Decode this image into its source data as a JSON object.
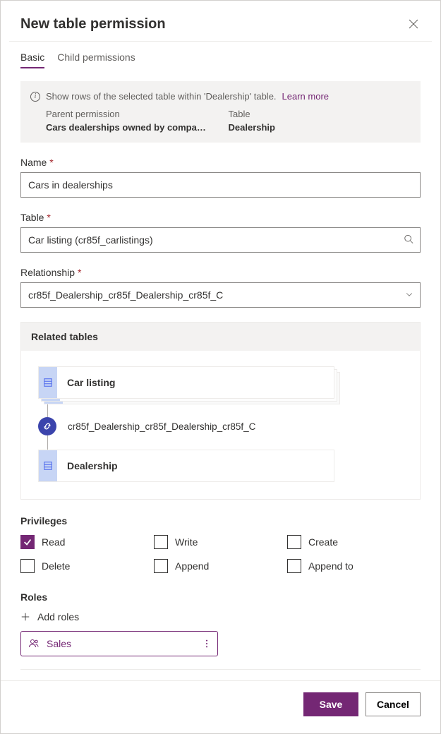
{
  "header": {
    "title": "New table permission"
  },
  "tabs": {
    "basic": "Basic",
    "child": "Child permissions"
  },
  "info": {
    "message": "Show rows of the selected table within 'Dealership' table.",
    "learn_more": "Learn more",
    "parent_permission_label": "Parent permission",
    "table_label": "Table",
    "parent_permission_value": "Cars dealerships owned by compa…",
    "table_value": "Dealership"
  },
  "fields": {
    "name_label": "Name",
    "name_value": "Cars in dealerships",
    "table_label": "Table",
    "table_value": "Car listing (cr85f_carlistings)",
    "relationship_label": "Relationship",
    "relationship_value": "cr85f_Dealership_cr85f_Dealership_cr85f_C"
  },
  "related": {
    "header": "Related tables",
    "top_table": "Car listing",
    "relationship": "cr85f_Dealership_cr85f_Dealership_cr85f_C",
    "bottom_table": "Dealership"
  },
  "privileges": {
    "title": "Privileges",
    "items": [
      {
        "label": "Read",
        "checked": true
      },
      {
        "label": "Write",
        "checked": false
      },
      {
        "label": "Create",
        "checked": false
      },
      {
        "label": "Delete",
        "checked": false
      },
      {
        "label": "Append",
        "checked": false
      },
      {
        "label": "Append to",
        "checked": false
      }
    ]
  },
  "roles": {
    "title": "Roles",
    "add_label": "Add roles",
    "items": [
      "Sales"
    ]
  },
  "footer": {
    "save": "Save",
    "cancel": "Cancel"
  }
}
